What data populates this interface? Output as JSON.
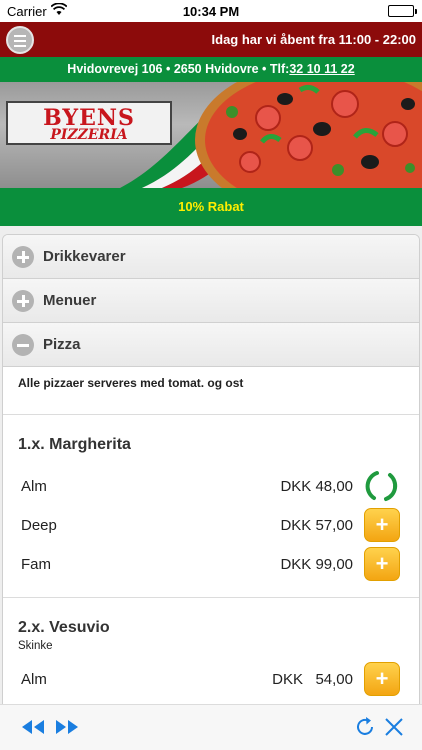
{
  "status_bar": {
    "carrier": "Carrier",
    "time": "10:34 PM"
  },
  "header": {
    "open_hours": "Idag har vi åbent fra 11:00 - 22:00",
    "menu_icon": "hamburger-menu-icon"
  },
  "address": {
    "text": "Hvidovrevej 106 • 2650 Hvidovre • Tlf:",
    "phone": "32 10 11 22"
  },
  "banner": {
    "logo_title": "BYENS",
    "logo_subtitle": "PIZZERIA"
  },
  "discount": "10% Rabat",
  "categories": [
    {
      "label": "Drikkevarer",
      "state": "collapsed"
    },
    {
      "label": "Menuer",
      "state": "collapsed"
    },
    {
      "label": "Pizza",
      "state": "expanded"
    }
  ],
  "pizza_section": {
    "note": "Alle pizzaer serveres med tomat. og ost",
    "products": [
      {
        "title": "1.x. Margherita",
        "variants": [
          {
            "name": "Alm",
            "price": "DKK 48,00",
            "action": "loading"
          },
          {
            "name": "Deep",
            "price": "DKK 57,00",
            "action": "add"
          },
          {
            "name": "Fam",
            "price": "DKK 99,00",
            "action": "add"
          }
        ]
      },
      {
        "title": "2.x. Vesuvio",
        "description": "Skinke",
        "variants": [
          {
            "name": "Alm",
            "price": "DKK   54,00",
            "action": "add"
          }
        ]
      }
    ]
  },
  "add_button_label": "+",
  "colors": {
    "header_red": "#8c0b0b",
    "brand_green": "#0a8f3c",
    "discount_yellow": "#ffee00",
    "add_button_orange": "#f3a512",
    "toolbar_blue": "#1a7ee0"
  },
  "toolbar": {
    "icons": [
      "rewind-icon",
      "fast-forward-icon",
      "refresh-icon",
      "close-icon"
    ]
  }
}
